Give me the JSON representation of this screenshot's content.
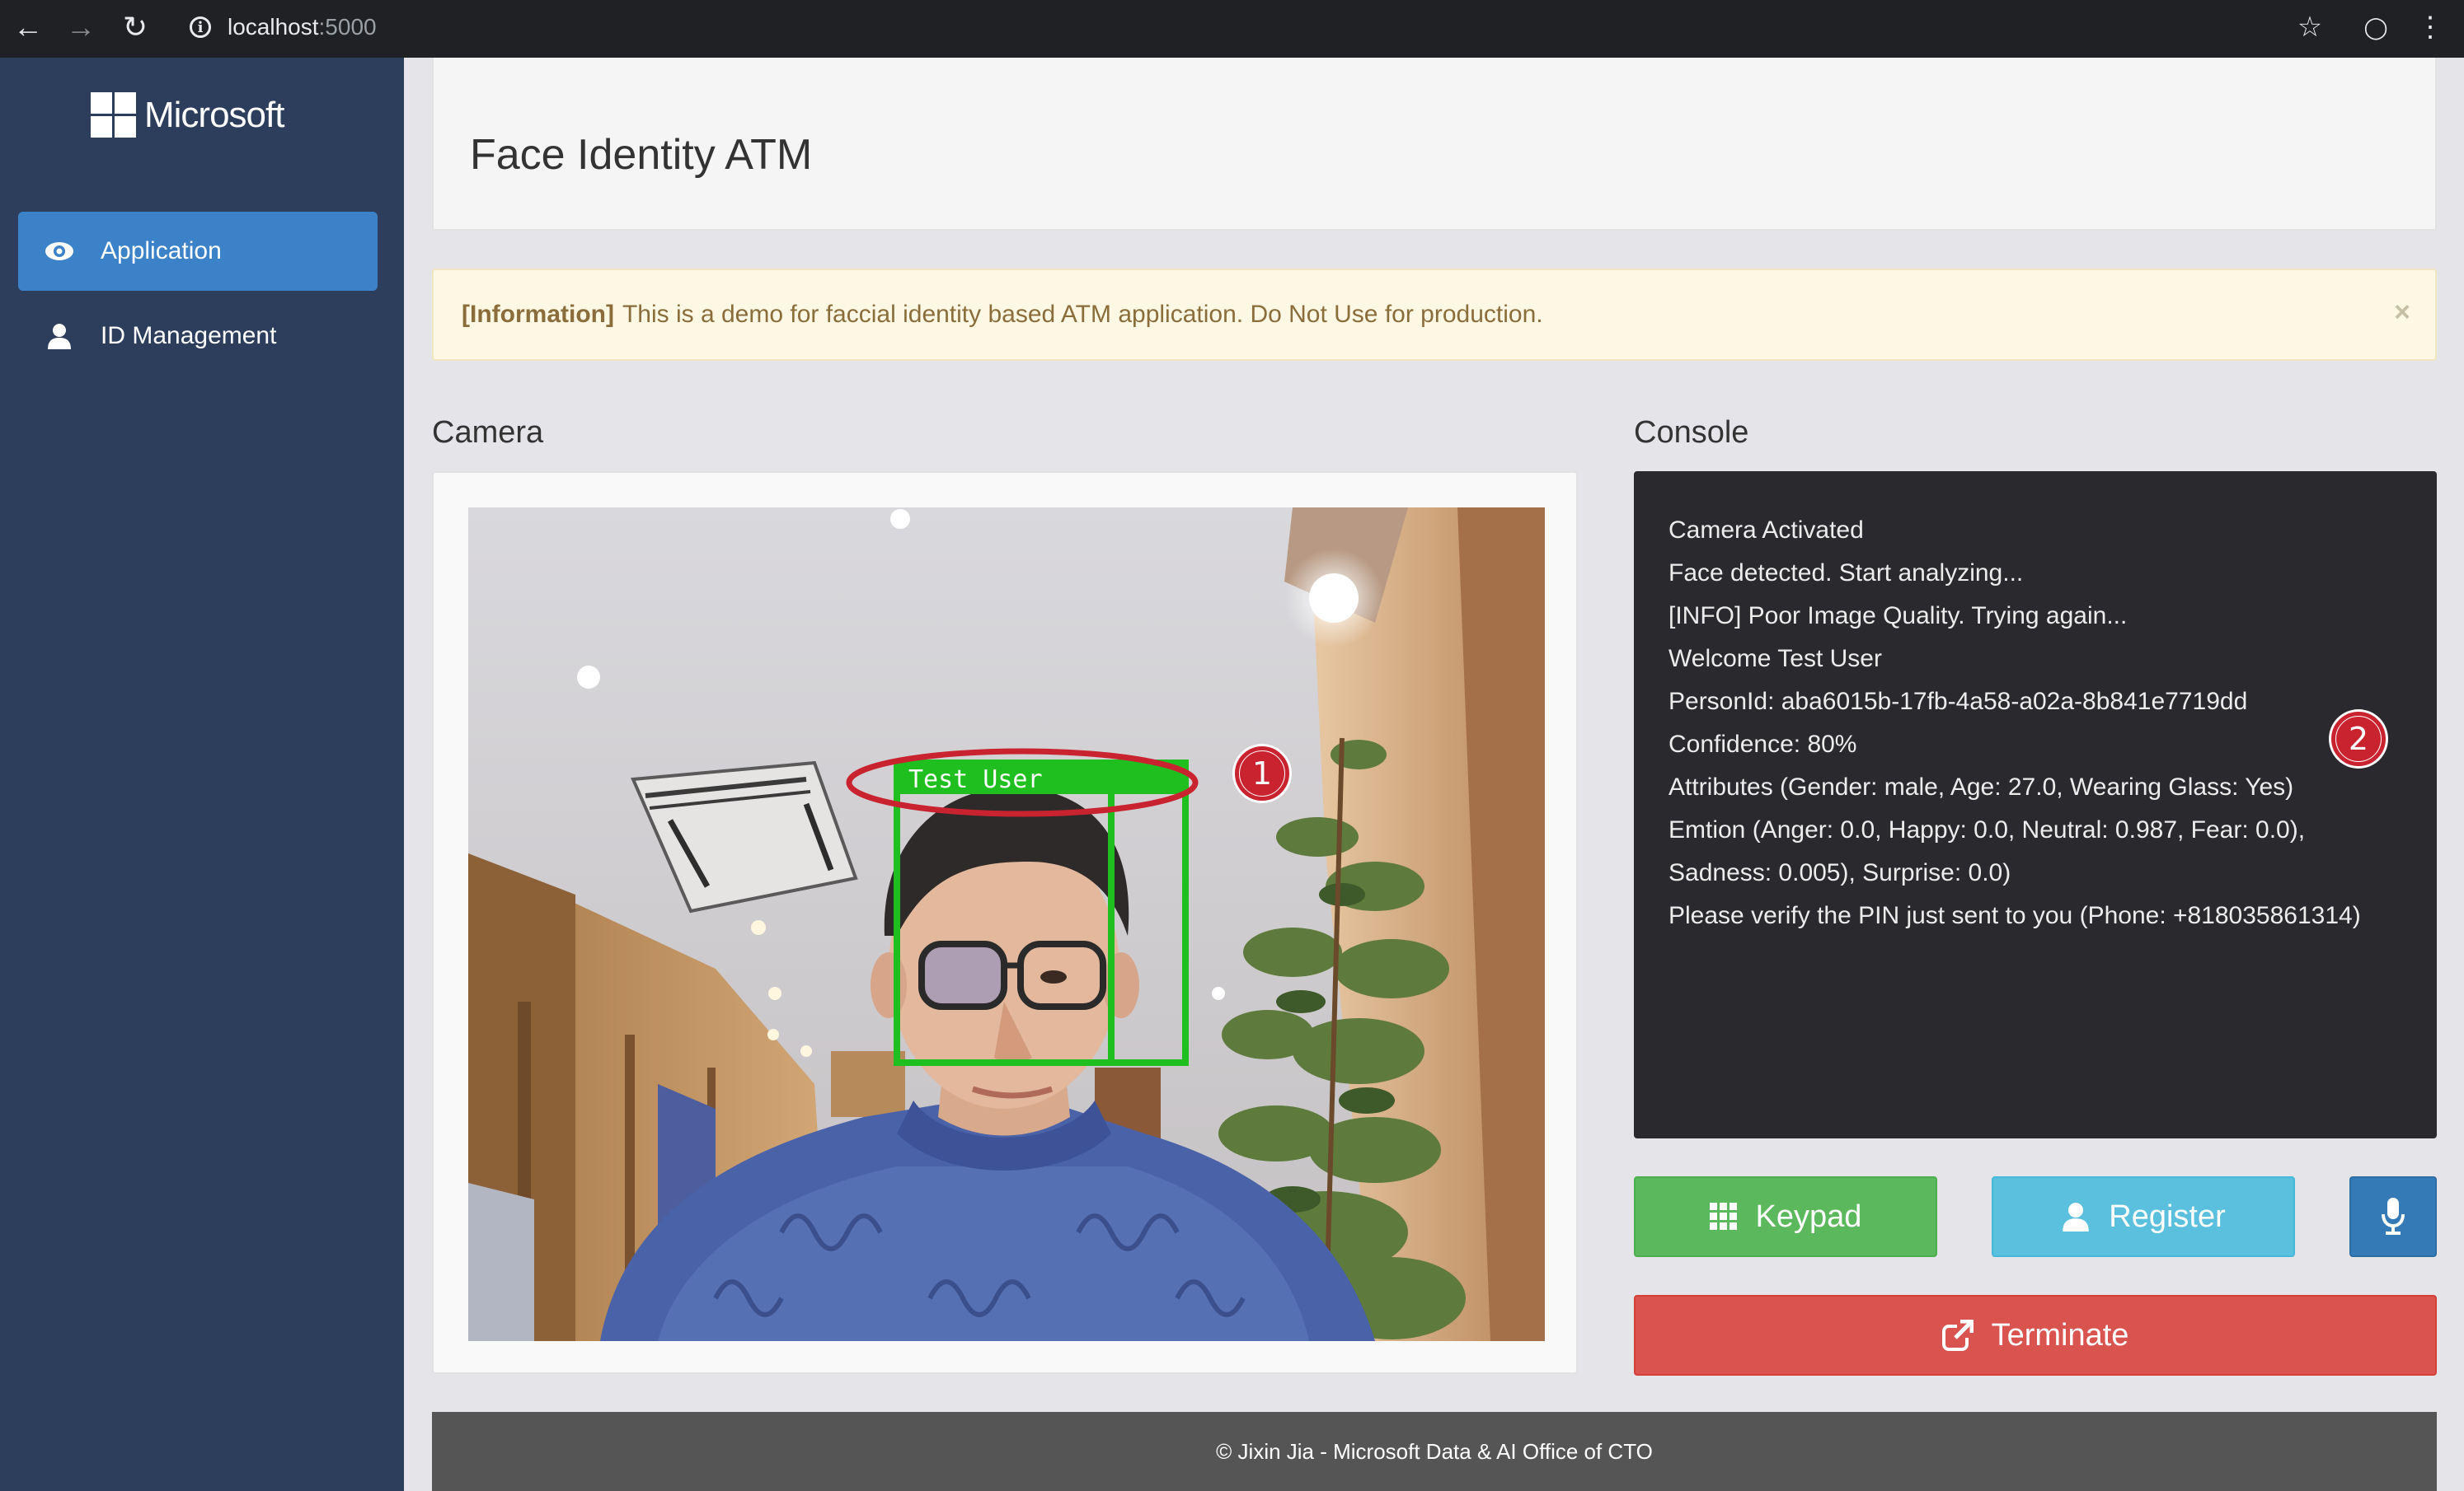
{
  "browser": {
    "url_host": "localhost",
    "url_port": ":5000"
  },
  "sidebar": {
    "brand": "Microsoft",
    "items": [
      {
        "label": "Application",
        "icon": "eye-icon",
        "active": true
      },
      {
        "label": "ID Management",
        "icon": "user-icon",
        "active": false
      }
    ]
  },
  "header": {
    "title": "Face Identity ATM"
  },
  "alert": {
    "tag": "[Information]",
    "message": "This is a demo for faccial identity based ATM application. Do Not Use for production.",
    "close": "×"
  },
  "camera": {
    "title": "Camera",
    "face_label": "Test User"
  },
  "console": {
    "title": "Console",
    "lines": [
      "Camera Activated",
      "Face detected. Start analyzing...",
      "[INFO] Poor Image Quality. Trying again...",
      "Welcome Test User",
      "PersonId: aba6015b-17fb-4a58-a02a-8b841e7719dd",
      "Confidence: 80%",
      "Attributes (Gender: male, Age: 27.0, Wearing Glass: Yes)",
      "Emtion (Anger: 0.0, Happy: 0.0, Neutral: 0.987, Fear: 0.0),",
      "Sadness: 0.005), Surprise: 0.0)",
      "Please verify the PIN just sent to you (Phone: +818035861314)"
    ]
  },
  "buttons": {
    "keypad": "Keypad",
    "register": "Register",
    "terminate": "Terminate"
  },
  "annotations": {
    "one": "1",
    "two": "2"
  },
  "footer": {
    "text": "© Jixin Jia - Microsoft Data & AI Office of CTO"
  },
  "colors": {
    "sidebar": "#2c3e5c",
    "active_nav": "#3b82c8",
    "keypad": "#5cb85c",
    "register": "#5bc0de",
    "mic": "#337ab7",
    "terminate": "#d9534f",
    "face_box": "#1fbf1f",
    "annotation": "#c9232f"
  }
}
